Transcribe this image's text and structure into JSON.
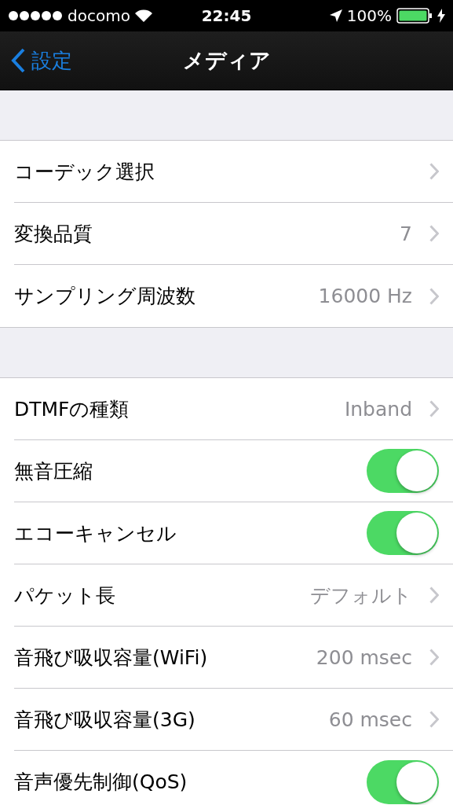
{
  "status_bar": {
    "carrier": "docomo",
    "time": "22:45",
    "battery": "100%"
  },
  "nav": {
    "back": "設定",
    "title": "メディア"
  },
  "sections": [
    {
      "rows": [
        {
          "kind": "link",
          "label": "コーデック選択"
        },
        {
          "kind": "link",
          "label": "変換品質",
          "value": "7"
        },
        {
          "kind": "link",
          "label": "サンプリング周波数",
          "value": "16000 Hz"
        }
      ]
    },
    {
      "rows": [
        {
          "kind": "link",
          "label": "DTMFの種類",
          "value": "Inband"
        },
        {
          "kind": "toggle",
          "label": "無音圧縮",
          "on": true
        },
        {
          "kind": "toggle",
          "label": "エコーキャンセル",
          "on": true
        },
        {
          "kind": "link",
          "label": "パケット長",
          "value": "デフォルト"
        },
        {
          "kind": "link",
          "label": "音飛び吸収容量(WiFi)",
          "value": "200 msec"
        },
        {
          "kind": "link",
          "label": "音飛び吸収容量(3G)",
          "value": "60 msec"
        },
        {
          "kind": "toggle",
          "label": "音声優先制御(QoS)",
          "on": true
        }
      ]
    }
  ]
}
